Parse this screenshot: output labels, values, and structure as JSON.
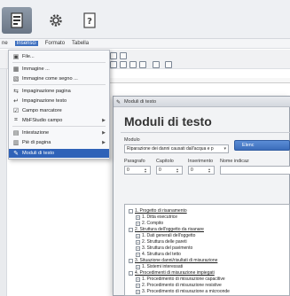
{
  "ribbon": {
    "buttons": [
      {
        "name": "document-icon",
        "selected": true
      },
      {
        "name": "gear-icon",
        "selected": false
      },
      {
        "name": "help-icon",
        "selected": false
      }
    ]
  },
  "menubar": {
    "items": [
      "ne",
      "Inserisci",
      "Formato",
      "Tabella"
    ],
    "active_index": 1
  },
  "menu": {
    "items": [
      {
        "icon": "file-icon",
        "label": "File...",
        "submenu": false
      },
      {
        "icon": "image-icon",
        "label": "Immagine ...",
        "submenu": false
      },
      {
        "icon": "image-link-icon",
        "label": "Immagine come segno ...",
        "submenu": false
      },
      {
        "icon": "page-break-icon",
        "label": "Impaginazione pagina",
        "submenu": false
      },
      {
        "icon": "text-break-icon",
        "label": "Impaginazione testo",
        "submenu": false
      },
      {
        "icon": "checkbox-field-icon",
        "label": "Campo marcatore",
        "submenu": false
      },
      {
        "icon": "mf-studio-icon",
        "label": "MbFStudio campo",
        "submenu": true
      },
      {
        "icon": "header-icon",
        "label": "Intestazione",
        "submenu": true
      },
      {
        "icon": "footer-icon",
        "label": "Piè di pagina",
        "submenu": true
      },
      {
        "icon": "text-module-icon",
        "label": "Moduli di testo",
        "submenu": false
      }
    ],
    "highlighted_index": 9
  },
  "dialog": {
    "title": "Moduli di testo",
    "heading": "Moduli di testo",
    "module_label": "Modulo",
    "module_value": "Riparazione dei danni causati dall'acqua e p",
    "paragraph_label": "Paragrafo",
    "paragraph_value": "0",
    "chapter_label": "Capitolo",
    "chapter_value": "0",
    "insertion_label": "Inserimento",
    "insertion_value": "0",
    "name_label": "Nome indicaz",
    "action_button": "Elenc"
  },
  "tree": {
    "items": [
      {
        "level": 0,
        "toggle": "-",
        "label": "1. Progetto di risanamento"
      },
      {
        "level": 1,
        "toggle": "+",
        "label": "1. Ditta esecutrice"
      },
      {
        "level": 1,
        "toggle": "+",
        "label": "2. Compito"
      },
      {
        "level": 0,
        "toggle": "-",
        "label": "2. Struttura dell'oggetto da risanare"
      },
      {
        "level": 1,
        "toggle": "+",
        "label": "1. Dati generali dell'oggetto"
      },
      {
        "level": 1,
        "toggle": "+",
        "label": "2. Struttura delle pareti"
      },
      {
        "level": 1,
        "toggle": "+",
        "label": "3. Struttura del pavimento"
      },
      {
        "level": 1,
        "toggle": "+",
        "label": "4. Struttura del tetto"
      },
      {
        "level": 0,
        "toggle": "-",
        "label": "3. Situazione danni/risultati di misurazione"
      },
      {
        "level": 1,
        "toggle": "+",
        "label": "1. Sistemi interessati"
      },
      {
        "level": 0,
        "toggle": "-",
        "label": "4. Procedimenti di misurazione impiegati"
      },
      {
        "level": 1,
        "toggle": "+",
        "label": "1. Procedimento di misurazione capacitive"
      },
      {
        "level": 1,
        "toggle": "+",
        "label": "2. Procedimento di misurazione resistive"
      },
      {
        "level": 1,
        "toggle": "+",
        "label": "3. Procedimento di misurazione a microonde"
      }
    ]
  },
  "colors": {
    "highlight": "#2f62b8",
    "ribbon_selected": "#7b8796",
    "action_button": "#3b6dbb"
  }
}
